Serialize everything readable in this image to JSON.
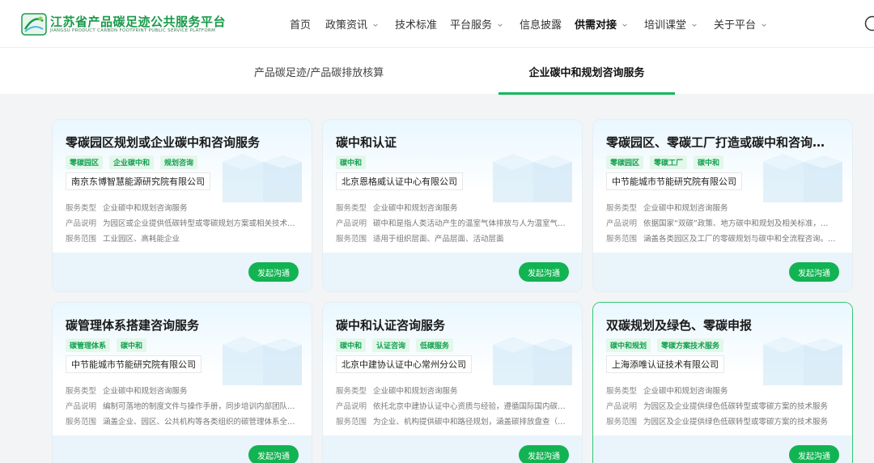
{
  "header": {
    "logo_title": "江苏省产品碳足迹公共服务平台",
    "logo_subtitle": "JIANGSU PRODUCT CARBON FOOTPRINT PUBLIC SERVICE PLATFORM",
    "nav": [
      {
        "label": "首页",
        "has_dropdown": false
      },
      {
        "label": "政策资讯",
        "has_dropdown": true
      },
      {
        "label": "技术标准",
        "has_dropdown": false
      },
      {
        "label": "平台服务",
        "has_dropdown": true
      },
      {
        "label": "信息披露",
        "has_dropdown": false
      },
      {
        "label": "供需对接",
        "has_dropdown": true,
        "active": true
      },
      {
        "label": "培训课堂",
        "has_dropdown": true
      },
      {
        "label": "关于平台",
        "has_dropdown": true
      }
    ]
  },
  "tabs": [
    {
      "label": "产品碳足迹/产品碳排放核算",
      "active": false
    },
    {
      "label": "企业碳中和规划咨询服务",
      "active": true
    }
  ],
  "labels": {
    "service_type": "服务类型",
    "product_desc": "产品说明",
    "service_scope": "服务范围",
    "action": "发起沟通"
  },
  "cards": [
    {
      "title": "零碳园区规划或企业碳中和咨询服务",
      "tags": [
        "零碳园区",
        "企业碳中和",
        "规划咨询"
      ],
      "company": "南京东博智慧能源研究院有限公司",
      "service_type": "企业碳中和规划咨询服务",
      "product_desc": "为园区或企业提供低碳转型或零碳规划方案或相关技术…",
      "service_scope": "工业园区、高耗能企业"
    },
    {
      "title": "碳中和认证",
      "tags": [
        "碳中和"
      ],
      "company": "北京恩格威认证中心有限公司",
      "service_type": "企业碳中和规划咨询服务",
      "product_desc": "碳中和是指人类活动产生的温室气体排放与人为温室气…",
      "service_scope": "适用于组织层面、产品层面、活动层面"
    },
    {
      "title": "零碳园区、零碳工厂打造或碳中和咨询…",
      "tags": [
        "零碳园区",
        "零碳工厂",
        "碳中和"
      ],
      "company": "中节能城市节能研究院有限公司",
      "service_type": "企业碳中和规划咨询服务",
      "product_desc": "依据国家“双碳”政策、地方碳中和规划及相关标准，…",
      "service_scope": "涵盖各类园区及工厂的零碳规划与碳中和全流程咨询。…"
    },
    {
      "title": "碳管理体系搭建咨询服务",
      "tags": [
        "碳管理体系",
        "碳中和"
      ],
      "company": "中节能城市节能研究院有限公司",
      "service_type": "企业碳中和规划咨询服务",
      "product_desc": "编制可落地的制度文件与操作手册，同步培训内部团队…",
      "service_scope": "涵盖企业、园区、公共机构等各类组织的碳管理体系全…"
    },
    {
      "title": "碳中和认证咨询服务",
      "tags": [
        "碳中和",
        "认证咨询",
        "低碳服务"
      ],
      "company": "北京中建协认证中心常州分公司",
      "service_type": "企业碳中和规划咨询服务",
      "product_desc": "依托北京中建协认证中心资质与经验，遵循国际国内碳…",
      "service_scope": "为企业、机构提供碳中和路径规划，涵盖碳排放盘查（…"
    },
    {
      "title": "双碳规划及绿色、零碳申报",
      "tags": [
        "碳中和规划",
        "零碳方案技术服务"
      ],
      "company": "上海添唯认证技术有限公司",
      "service_type": "企业碳中和规划咨询服务",
      "product_desc": "为园区及企业提供绿色低碳转型或零碳方案的技术服务",
      "service_scope": "为园区及企业提供绿色低碳转型或零碳方案的技术服务",
      "highlight": true
    }
  ]
}
